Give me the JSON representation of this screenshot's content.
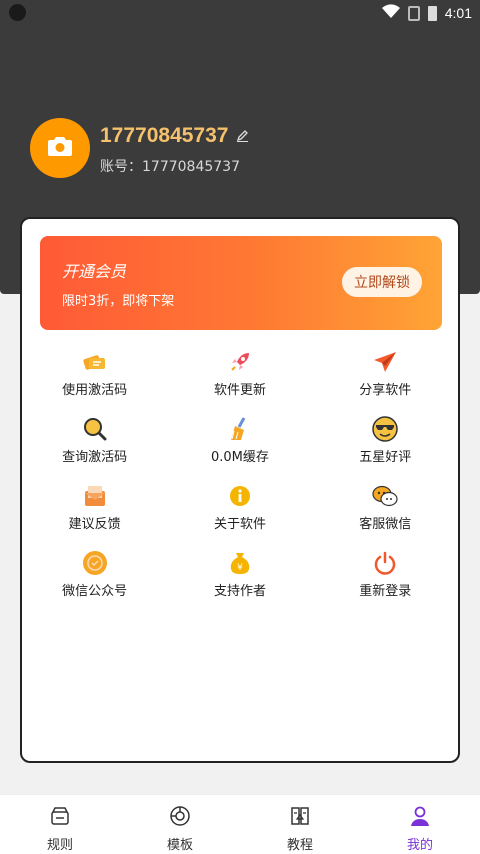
{
  "status_bar": {
    "time": "4:01"
  },
  "profile": {
    "username": "17770845737",
    "account_label": "账号：17770845737"
  },
  "vip_banner": {
    "title": "开通会员",
    "subtitle": "限时3折，即将下架",
    "button_label": "立即解锁"
  },
  "menu": [
    {
      "label": "使用激活码",
      "icon": "ticket-icon",
      "color": "#f5a623"
    },
    {
      "label": "软件更新",
      "icon": "rocket-icon",
      "color": "#ef4b5a"
    },
    {
      "label": "分享软件",
      "icon": "paper-plane-icon",
      "color": "#f25a2d"
    },
    {
      "label": "查询激活码",
      "icon": "magnifier-icon",
      "color": "#f5a623"
    },
    {
      "label": "0.0M缓存",
      "icon": "broom-icon",
      "color": "#f5a623"
    },
    {
      "label": "五星好评",
      "icon": "cool-emoji-icon",
      "color": "#f5c242"
    },
    {
      "label": "建议反馈",
      "icon": "mail-icon",
      "color": "#f08c3a"
    },
    {
      "label": "关于软件",
      "icon": "info-icon",
      "color": "#f5b400"
    },
    {
      "label": "客服微信",
      "icon": "wechat-icon",
      "color": "#f5a623"
    },
    {
      "label": "微信公众号",
      "icon": "official-account-icon",
      "color": "#f5a623"
    },
    {
      "label": "支持作者",
      "icon": "money-bag-icon",
      "color": "#f5b400"
    },
    {
      "label": "重新登录",
      "icon": "power-icon",
      "color": "#f0572d"
    }
  ],
  "tabs": [
    {
      "label": "规则",
      "icon": "rules-icon",
      "active": false
    },
    {
      "label": "模板",
      "icon": "template-icon",
      "active": false
    },
    {
      "label": "教程",
      "icon": "tutorial-icon",
      "active": false
    },
    {
      "label": "我的",
      "icon": "profile-icon",
      "active": true
    }
  ],
  "colors": {
    "accent": "#7a32d8",
    "username": "#f5c16c",
    "avatar": "#ff9900",
    "header_bg": "#3b3b3b"
  }
}
